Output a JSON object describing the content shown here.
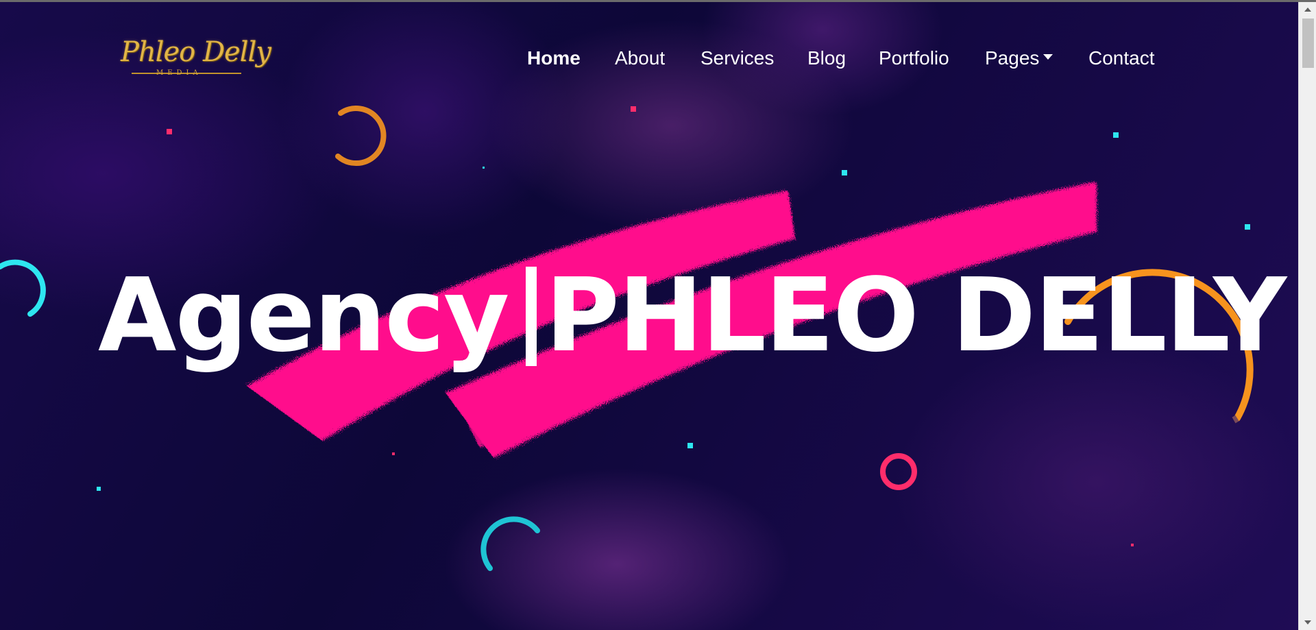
{
  "logo": {
    "script_text": "Phleo Delly",
    "sub_text": "MEDIA"
  },
  "nav": {
    "items": [
      {
        "label": "Home",
        "active": true
      },
      {
        "label": "About"
      },
      {
        "label": "Services"
      },
      {
        "label": "Blog"
      },
      {
        "label": "Portfolio"
      },
      {
        "label": "Pages",
        "has_dropdown": true
      },
      {
        "label": "Contact"
      }
    ]
  },
  "hero": {
    "headline_prefix": "Agency",
    "headline_name": "PHLEO DELLY"
  },
  "colors": {
    "background": "#0b0636",
    "brush_pink": "#ff0a8c",
    "accent_orange": "#f7931e",
    "accent_cyan": "#2ee6f0",
    "accent_red": "#ff2d6b",
    "logo_gold": "#e2b547"
  }
}
